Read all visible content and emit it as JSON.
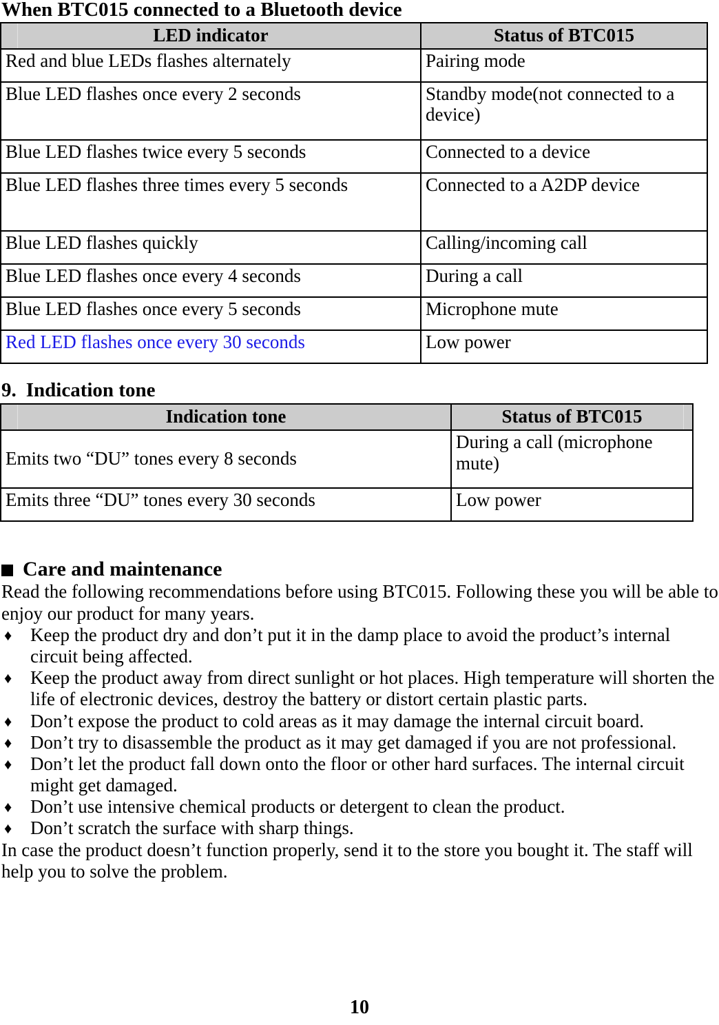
{
  "page": {
    "number": "10"
  },
  "led_section": {
    "title": "When BTC015 connected to a Bluetooth device",
    "table": {
      "headers": [
        "LED indicator",
        "Status of BTC015"
      ],
      "rows": [
        [
          "Red and blue LEDs flashes alternately",
          "Pairing mode"
        ],
        [
          "Blue LED flashes once every 2 seconds",
          "Standby mode(not connected to a device)"
        ],
        [
          "Blue LED flashes twice every 5 seconds",
          "Connected to a device"
        ],
        [
          "Blue LED flashes three times every 5 seconds",
          "Connected to a A2DP device"
        ],
        [
          "Blue LED flashes quickly",
          "Calling/incoming call"
        ],
        [
          "Blue LED flashes once every 4 seconds",
          "During a call"
        ],
        [
          "Blue LED flashes once every 5 seconds",
          "Microphone mute"
        ],
        [
          "Red LED flashes once every 30 seconds",
          "Low power"
        ]
      ],
      "highlight_color": "#1a1ae6"
    }
  },
  "tone_section": {
    "number": "9.",
    "title": "Indication tone",
    "table": {
      "headers": [
        "Indication tone",
        "Status of BTC015"
      ],
      "rows": [
        [
          "Emits two “DU” tones every 8 seconds",
          "During a call (microphone mute)"
        ],
        [
          "Emits three “DU” tones every 30 seconds",
          "Low power"
        ]
      ]
    }
  },
  "care_section": {
    "bullet_icon": "square-bullet-icon",
    "heading": "Care and maintenance",
    "intro": "Read the following recommendations before using BTC015. Following these you will be able to enjoy our product for many years.",
    "bullet_glyph": "♦",
    "bullets": [
      "Keep the product dry and don’t put it in the damp place to avoid the product’s internal circuit being affected.",
      "Keep the product away from direct sunlight or hot places. High temperature will shorten the life of electronic devices, destroy the battery or distort certain plastic parts.",
      "Don’t expose the product to cold areas as it may damage the internal circuit board.",
      "Don’t try to disassemble the product as it may get damaged if you are not professional.",
      "Don’t let the product fall down onto the floor or other hard surfaces. The internal circuit might get damaged.",
      "Don’t use intensive chemical products or detergent to clean the product.",
      "Don’t scratch the surface with sharp things."
    ],
    "outro": "In case the product doesn’t function properly, send it to the store you bought it. The staff will help you to solve the problem."
  }
}
